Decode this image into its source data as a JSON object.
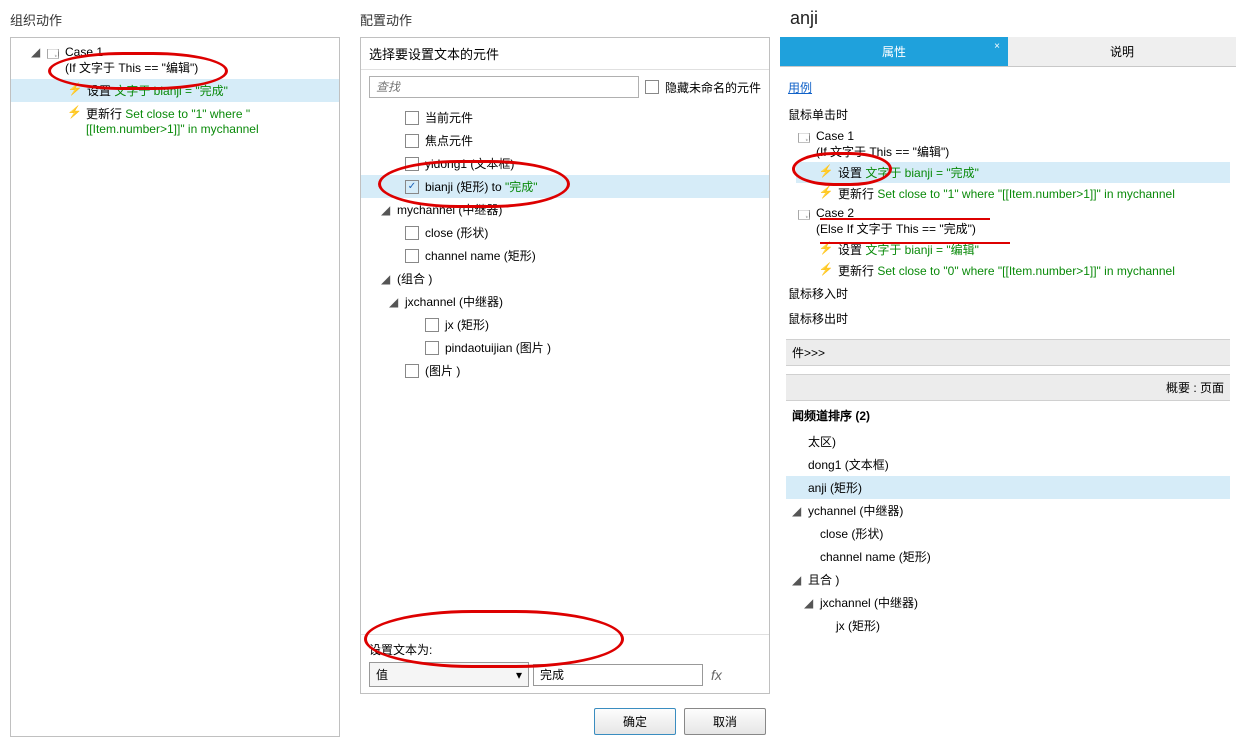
{
  "left": {
    "title": "组织动作",
    "rows": [
      {
        "type": "case",
        "label": "Case 1",
        "sub": "(If 文字于 This == \"编辑\")"
      },
      {
        "type": "action",
        "pre": "设置 ",
        "green": "文字于 bianji = \"完成\"",
        "selected": true
      },
      {
        "type": "action",
        "pre": "更新行 ",
        "green": "Set close to \"1\" where \"[[Item.number>1]]\" in mychannel"
      }
    ]
  },
  "mid": {
    "title": "配置动作",
    "header": "选择要设置文本的元件",
    "search_placeholder": "查找",
    "hide_unnamed": "隐藏未命名的元件",
    "elements": [
      {
        "lvl": 1,
        "label": "当前元件"
      },
      {
        "lvl": 1,
        "label": "焦点元件"
      },
      {
        "lvl": 1,
        "label": "yidong1 (文本框)"
      },
      {
        "lvl": 1,
        "label": "bianji (矩形) to ",
        "suffix_green": "\"完成\"",
        "checked": true,
        "selected": true
      },
      {
        "lvl": 0,
        "arrow": true,
        "label": "mychannel (中继器)"
      },
      {
        "lvl": 1,
        "label": "close (形状)"
      },
      {
        "lvl": 1,
        "label": "channel name (矩形)"
      },
      {
        "lvl": 0,
        "arrow": true,
        "label": "(组合 )"
      },
      {
        "lvl": 1,
        "arrow": true,
        "label": "jxchannel (中继器)"
      },
      {
        "lvl": 2,
        "label": "jx (矩形)"
      },
      {
        "lvl": 2,
        "label": "pindaotuijian (图片 )"
      },
      {
        "lvl": 1,
        "label": "(图片 )"
      }
    ],
    "set_text_label": "设置文本为:",
    "dropdown_value": "值",
    "value_input": "完成",
    "fx": "fx",
    "ok": "确定",
    "cancel": "取消"
  },
  "right": {
    "widget_name": "anji",
    "tab_props": "属性",
    "tab_notes": "说明",
    "add_case": "用例",
    "ev_click": "鼠标单击时",
    "ev_movein": "鼠标移入时",
    "ev_moveout": "鼠标移出时",
    "case1": "Case 1",
    "case1_cond": "(If 文字于 This == \"编辑\")",
    "case1_a1_pre": "设置 ",
    "case1_a1_green": "文字于 bianji = \"完成\"",
    "case1_a2_pre": "更新行 ",
    "case1_a2_green": "Set close to \"1\" where \"[[Item.number>1]]\" in mychannel",
    "case2": "Case 2",
    "case2_cond": "(Else If 文字于 This == \"完成\")",
    "case2_a1_pre": "设置 ",
    "case2_a1_green": "文字于 bianji = \"编辑\"",
    "case2_a2_pre": "更新行 ",
    "case2_a2_green": "Set close to \"0\" where \"[[Item.number>1]]\" in mychannel",
    "more_events": "件>>>",
    "outline_hdr": "概要 : 页面",
    "outline_title": "闻频道排序 (2)",
    "outline": [
      {
        "lvl": 0,
        "label": "太区)"
      },
      {
        "lvl": 0,
        "label": "dong1 (文本框)"
      },
      {
        "lvl": 0,
        "label": "anji (矩形)",
        "selected": true
      },
      {
        "lvl": 0,
        "label": "ychannel (中继器)",
        "arrow": true
      },
      {
        "lvl": 1,
        "label": "close (形状)"
      },
      {
        "lvl": 1,
        "label": "channel name (矩形)"
      },
      {
        "lvl": 0,
        "label": "且合 )",
        "arrow": true
      },
      {
        "lvl": 1,
        "label": "jxchannel (中继器)",
        "arrow": true
      },
      {
        "lvl": 2,
        "label": "jx (矩形)"
      }
    ]
  }
}
